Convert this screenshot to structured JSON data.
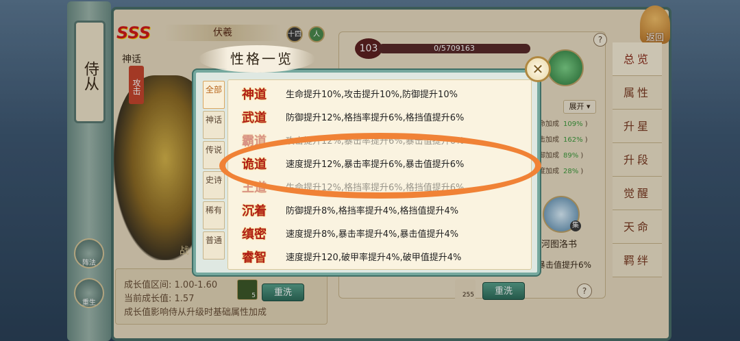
{
  "hero": {
    "rank_badge": "SSS",
    "tier": "神话",
    "name": "伏羲",
    "level_icon": "十四",
    "person_icon": "人",
    "role_tag": "攻击",
    "portrait_caption": "战"
  },
  "left_panel": {
    "scroll_title": "侍从",
    "circle1_label": "阵法",
    "circle2_label": "重生"
  },
  "growth": {
    "range_label": "成长值区间:",
    "range_value": "1.00-1.60",
    "current_label": "当前成长值:",
    "current_value": "1.57",
    "note": "成长值影响侍从升级时基础属性加成",
    "reset_label": "重洗",
    "item_count": "5"
  },
  "level_area": {
    "level": "103",
    "exp": "0/5709163"
  },
  "stats_panel": {
    "expand_label": "展开",
    "rows": [
      {
        "label": "生命加成",
        "pct": "109%"
      },
      {
        "label": "攻击加成",
        "pct": "162%"
      },
      {
        "label": "防御加成",
        "pct": "89%"
      },
      {
        "label": "速度加成",
        "pct": "28%"
      }
    ],
    "hetu_label": "河图洛书",
    "hetu_badge": "集",
    "crit_label": "暴击值提升6%",
    "reset_label": "重洗",
    "item_count": "255",
    "help_label": "?"
  },
  "right_menu": {
    "return_label": "返回",
    "items": [
      "总览",
      "属性",
      "升星",
      "升段",
      "觉醒",
      "天命",
      "羁绊"
    ]
  },
  "modal": {
    "title": "性格一览",
    "close_label": "✕",
    "tabs": [
      "全部",
      "神话",
      "传说",
      "史诗",
      "稀有",
      "普通"
    ],
    "traits": [
      {
        "name": "神道",
        "desc": "生命提升10%,攻击提升10%,防御提升10%"
      },
      {
        "name": "武道",
        "desc": "防御提升12%,格挡率提升6%,格挡值提升6%"
      },
      {
        "name": "霸道",
        "desc": "攻击提升12%,暴击率提升6%,暴击值提升6%"
      },
      {
        "name": "诡道",
        "desc": "速度提升12%,暴击率提升6%,暴击值提升6%"
      },
      {
        "name": "王道",
        "desc": "生命提升12%,格挡率提升6%,格挡值提升6%"
      },
      {
        "name": "沉着",
        "desc": "防御提升8%,格挡率提升4%,格挡值提升4%"
      },
      {
        "name": "缜密",
        "desc": "速度提升8%,暴击率提升4%,暴击值提升4%"
      },
      {
        "name": "睿智",
        "desc": "速度提升120,破甲率提升4%,破甲值提升4%"
      }
    ]
  },
  "colors": {
    "highlight": "#f08236",
    "trait_name": "#b01e18",
    "active_tab": "#b8661c"
  }
}
